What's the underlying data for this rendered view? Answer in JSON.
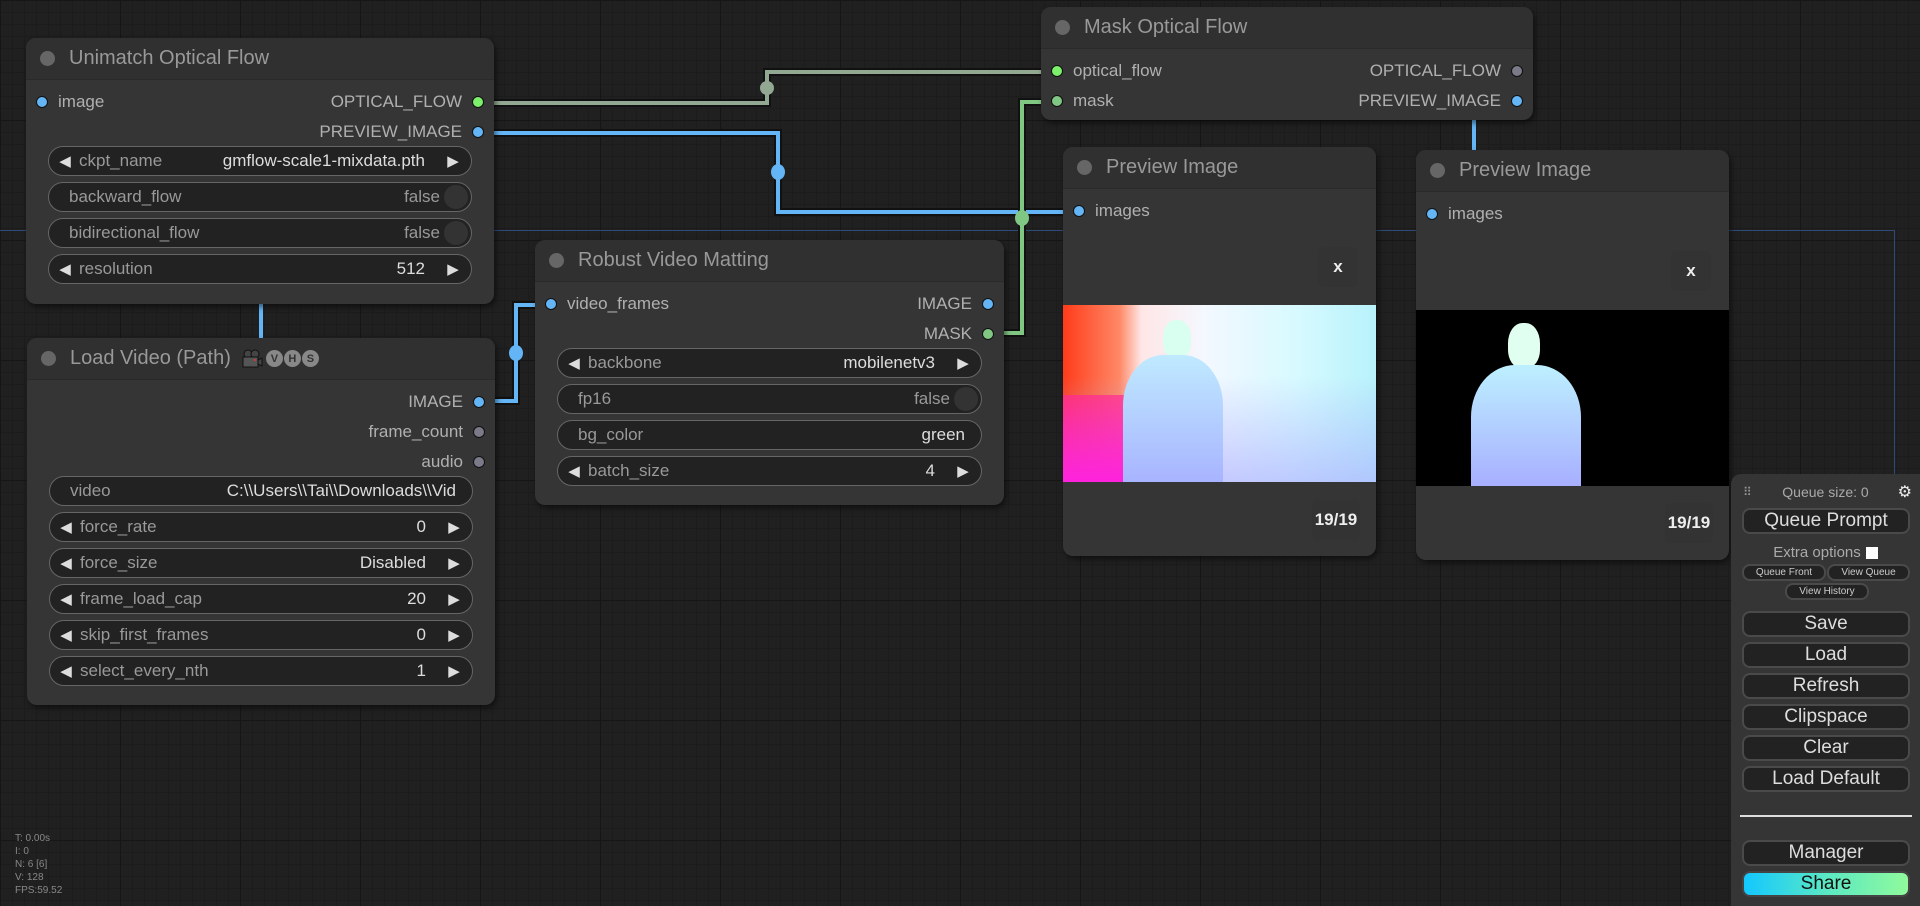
{
  "canvas": {
    "stats": {
      "time": "T: 0.00s",
      "iterations": "I: 0",
      "nodes": "N: 6 [6]",
      "vertices": "V: 128",
      "fps": "FPS:59.52"
    }
  },
  "nodes": {
    "unimatch": {
      "title": "Unimatch Optical Flow",
      "inputs": [
        {
          "label": "image",
          "color": "#64b5f6"
        }
      ],
      "outputs": [
        {
          "label": "OPTICAL_FLOW",
          "color": "#7cf06a"
        },
        {
          "label": "PREVIEW_IMAGE",
          "color": "#64b5f6"
        }
      ],
      "widgets": {
        "ckpt_name": {
          "label": "ckpt_name",
          "value": "gmflow-scale1-mixdata.pth"
        },
        "backward_flow": {
          "label": "backward_flow",
          "value": "false"
        },
        "bidirectional_flow": {
          "label": "bidirectional_flow",
          "value": "false"
        },
        "resolution": {
          "label": "resolution",
          "value": "512"
        }
      }
    },
    "load_video": {
      "title": "Load Video (Path)",
      "badges": [
        "V",
        "H",
        "S"
      ],
      "outputs": [
        {
          "label": "IMAGE",
          "color": "#64b5f6"
        },
        {
          "label": "frame_count",
          "color": "#7a7a88"
        },
        {
          "label": "audio",
          "color": "#7a7a88"
        }
      ],
      "widgets": {
        "video": {
          "label": "video",
          "value": "C:\\\\Users\\\\Tai\\\\Downloads\\\\Vid"
        },
        "force_rate": {
          "label": "force_rate",
          "value": "0"
        },
        "force_size": {
          "label": "force_size",
          "value": "Disabled"
        },
        "frame_load_cap": {
          "label": "frame_load_cap",
          "value": "20"
        },
        "skip_first_frames": {
          "label": "skip_first_frames",
          "value": "0"
        },
        "select_every_nth": {
          "label": "select_every_nth",
          "value": "1"
        }
      }
    },
    "rvm": {
      "title": "Robust Video Matting",
      "inputs": [
        {
          "label": "video_frames",
          "color": "#64b5f6"
        }
      ],
      "outputs": [
        {
          "label": "IMAGE",
          "color": "#64b5f6"
        },
        {
          "label": "MASK",
          "color": "#81c784"
        }
      ],
      "widgets": {
        "backbone": {
          "label": "backbone",
          "value": "mobilenetv3"
        },
        "fp16": {
          "label": "fp16",
          "value": "false"
        },
        "bg_color": {
          "label": "bg_color",
          "value": "green"
        },
        "batch_size": {
          "label": "batch_size",
          "value": "4"
        }
      }
    },
    "mask_flow": {
      "title": "Mask Optical Flow",
      "inputs": [
        {
          "label": "optical_flow",
          "color": "#7cf06a"
        },
        {
          "label": "mask",
          "color": "#81c784"
        }
      ],
      "outputs": [
        {
          "label": "OPTICAL_FLOW",
          "color": "#7a7a88"
        },
        {
          "label": "PREVIEW_IMAGE",
          "color": "#64b5f6"
        }
      ]
    },
    "preview1": {
      "title": "Preview Image",
      "input": "images",
      "close": "x",
      "counter": "19/19"
    },
    "preview2": {
      "title": "Preview Image",
      "input": "images",
      "close": "x",
      "counter": "19/19"
    }
  },
  "links": {
    "colors": {
      "optical_flow": "#92a892",
      "image": "#64b5f6",
      "mask": "#81c784"
    }
  },
  "menu": {
    "queue_size": "Queue size: 0",
    "queue_prompt": "Queue Prompt",
    "extra_options": "Extra options",
    "extra_options_checked": false,
    "queue_front": "Queue Front",
    "view_queue": "View Queue",
    "view_history": "View History",
    "save": "Save",
    "load": "Load",
    "refresh": "Refresh",
    "clipspace": "Clipspace",
    "clear": "Clear",
    "load_default": "Load Default",
    "manager": "Manager",
    "share": "Share"
  }
}
